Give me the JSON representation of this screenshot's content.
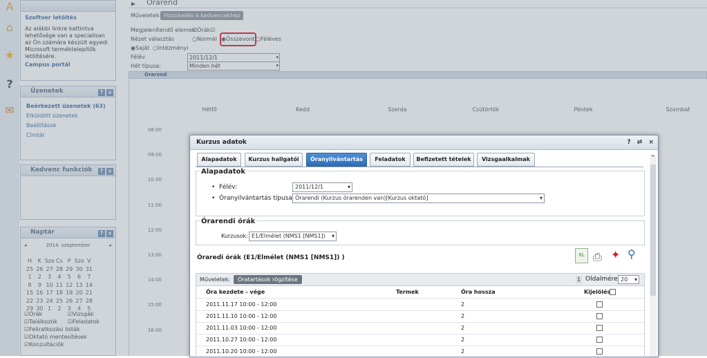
{
  "sidebar": {
    "software": {
      "title": "Szoftver letöltés",
      "text": "Az alábbi linkre kattintva lehetősége van a specialisan az Ön számára készült egyedi Microsoft terméktelepítők letöltésére.",
      "link": "Campus portál"
    },
    "messages": {
      "title": "Üzenetek",
      "items": [
        "Beérkezett üzenetek (63)",
        "Elküldött üzenetek",
        "Beállítások",
        "Címtár"
      ]
    },
    "favorites": {
      "title": "Kedvenc funkciók"
    },
    "calendar": {
      "title": "Naptár",
      "month": "2014. szeptember",
      "weekdays": [
        "H",
        "K",
        "Sze",
        "Cs",
        "P",
        "Szo",
        "V"
      ],
      "rows": [
        [
          "25",
          "26",
          "27",
          "28",
          "29",
          "30",
          "31"
        ],
        [
          "1",
          "2",
          "3",
          "4",
          "5",
          "6",
          "7"
        ],
        [
          "8",
          "9",
          "10",
          "11",
          "12",
          "13",
          "14"
        ],
        [
          "15",
          "16",
          "17",
          "18",
          "19",
          "20",
          "21"
        ],
        [
          "22",
          "23",
          "24",
          "25",
          "26",
          "27",
          "28"
        ],
        [
          "29",
          "30",
          "1",
          "2",
          "3",
          "4",
          "5"
        ]
      ],
      "filters_left": [
        "Órák",
        "Találkozók",
        "Feliratkozási listák",
        "Oktató mentesítések",
        "Konzultációk"
      ],
      "filters_right": [
        "Vizsgák",
        "Feladatok"
      ]
    }
  },
  "main": {
    "page_title": "Órarend",
    "ops_label": "Műveletek:",
    "add_fav_button": "Hozzáadás a kedvencekhez",
    "show_label": "Megjelenítendő elemek:",
    "show_option": "Órák",
    "view_label": "Nézet választás",
    "view_options": [
      "Normál",
      "Összevont",
      "Féléves"
    ],
    "scope_options": [
      "Saját",
      "Intézményi"
    ],
    "semester_label": "Félév",
    "semester_value": "2011/12/1",
    "week_label": "Hét típusa:",
    "week_value": "Minden hét",
    "calendar_header": "Órarend",
    "days": [
      "Hétfő",
      "Kedd",
      "Szerda",
      "Csütörtök",
      "Péntek",
      "Szombat"
    ],
    "times": [
      "08:00",
      "09:00",
      "10:00",
      "11:00",
      "12:00",
      "13:00",
      "14:00",
      "15:00",
      "16:00"
    ]
  },
  "modal": {
    "title": "Kurzus adatok",
    "title_buttons": [
      "?",
      "⇄",
      "×"
    ],
    "tabs": [
      "Alapadatok",
      "Kurzus hallgatói",
      "Óranyilvántartás",
      "Feladatok",
      "Befizetett tételek",
      "Vizsgaalkalmak"
    ],
    "active_tab": "Óranyilvántartás",
    "basic": {
      "legend": "Alapadatok",
      "semester_label": "Félév:",
      "semester_value": "2011/12/1",
      "type_label": "Óranyilvántartás típusa:",
      "type_value": "Órarendi (Kurzus órarenden van)[Kurzus oktató]"
    },
    "classes": {
      "legend": "Órarendi órák",
      "course_label": "Kurzusok:",
      "course_value": "E1/Elmélet (NMS1 [NMS1])"
    },
    "list_title": "Óraredi órák (E1/Elmélet (NMS1 [NMS1]) )",
    "ops_label": "Műveletek:",
    "ops_button": "Óratartások rögzítése",
    "page_num": "1",
    "page_size_label": "Oldalméret",
    "page_size_value": "20",
    "columns": [
      "Óra kezdete - vége",
      "Termek",
      "Óra hossza",
      "Kijelölés"
    ],
    "rows": [
      [
        "2011.11.17 10:00 - 12:00",
        "",
        "2"
      ],
      [
        "2011.11.10 10:00 - 12:00",
        "",
        "2"
      ],
      [
        "2011.11.03 10:00 - 12:00",
        "",
        "2"
      ],
      [
        "2011.10.27 10:00 - 12:00",
        "",
        "2"
      ],
      [
        "2011.10.20 10:00 - 12:00",
        "",
        "2"
      ]
    ]
  },
  "colors": {
    "active_tab": "#2d6db8",
    "highlight_box": "#e0141e",
    "link": "#3a6aa0"
  }
}
